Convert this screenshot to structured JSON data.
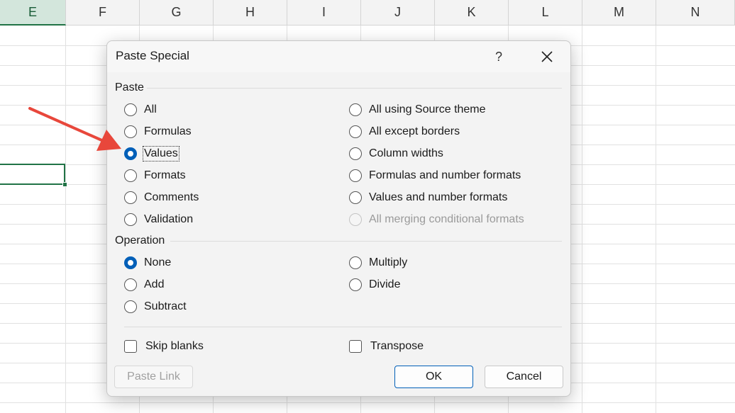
{
  "sheet": {
    "columns": [
      "E",
      "F",
      "G",
      "H",
      "I",
      "J",
      "K",
      "L",
      "M",
      "N"
    ],
    "active_column": "E"
  },
  "dialog": {
    "title": "Paste Special",
    "help_label": "?",
    "paste_group": {
      "label": "Paste",
      "left": [
        "All",
        "Formulas",
        "Values",
        "Formats",
        "Comments",
        "Validation"
      ],
      "right": [
        "All using Source theme",
        "All except borders",
        "Column widths",
        "Formulas and number formats",
        "Values and number formats",
        "All merging conditional formats"
      ],
      "selected": "Values",
      "disabled": [
        "All merging conditional formats"
      ]
    },
    "operation_group": {
      "label": "Operation",
      "left": [
        "None",
        "Add",
        "Subtract"
      ],
      "right": [
        "Multiply",
        "Divide"
      ],
      "selected": "None"
    },
    "checkboxes": {
      "skip_blanks": "Skip blanks",
      "transpose": "Transpose"
    },
    "buttons": {
      "paste_link": "Paste Link",
      "ok": "OK",
      "cancel": "Cancel"
    }
  },
  "colors": {
    "accent": "#005fb8",
    "excel_green": "#217346",
    "arrow": "#e8473b"
  }
}
